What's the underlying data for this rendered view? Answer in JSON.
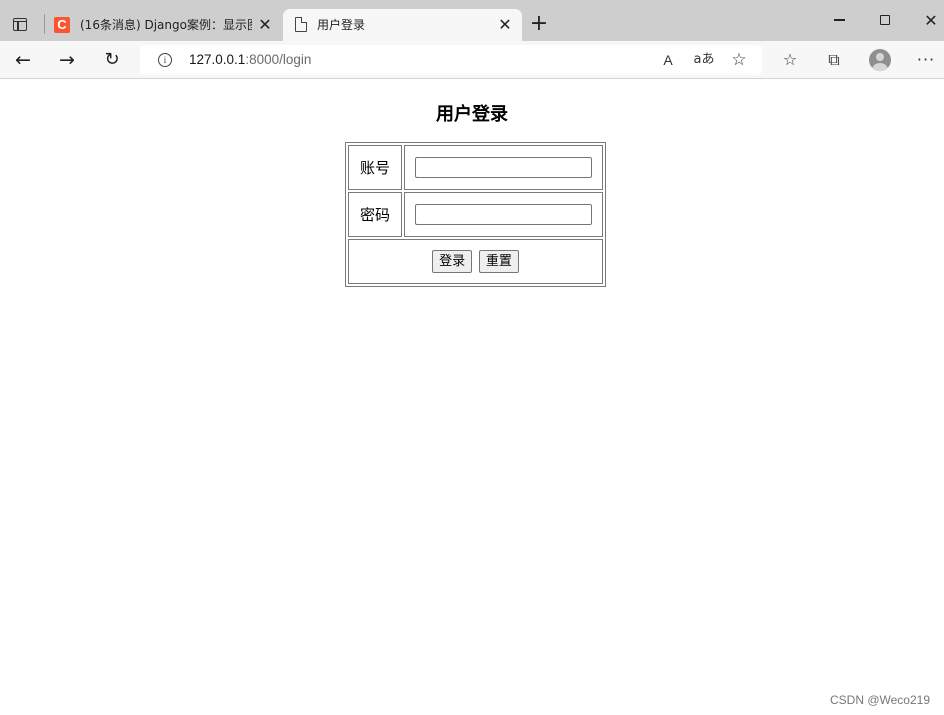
{
  "browser": {
    "tabs": [
      {
        "title": "(16条消息) Django案例：显示图",
        "active": false,
        "favicon": "csdn-c-icon",
        "favicon_letter": "C"
      },
      {
        "title": "用户登录",
        "active": true,
        "favicon": "document-icon"
      }
    ],
    "new_tab_glyph": "+",
    "close_glyph": "✕",
    "address": {
      "host": "127.0.0.1",
      "path": ":8000/login"
    },
    "icons": {
      "back": "←",
      "forward": "→",
      "reload": "↻",
      "info": "i",
      "read_aloud": "A",
      "translate": "aあ",
      "favorite_add": "☆",
      "favorites": "☆",
      "collections": "⧉",
      "more": "···"
    },
    "colors": {
      "csdn_brand": "#fc5531",
      "tab_strip": "#cecece",
      "toolbar": "#f7f7f7"
    }
  },
  "page": {
    "heading": "用户登录",
    "form": {
      "account_label": "账号",
      "account_value": "",
      "password_label": "密码",
      "password_value": "",
      "login_button": "登录",
      "reset_button": "重置"
    },
    "watermark": "CSDN @Weco219"
  }
}
